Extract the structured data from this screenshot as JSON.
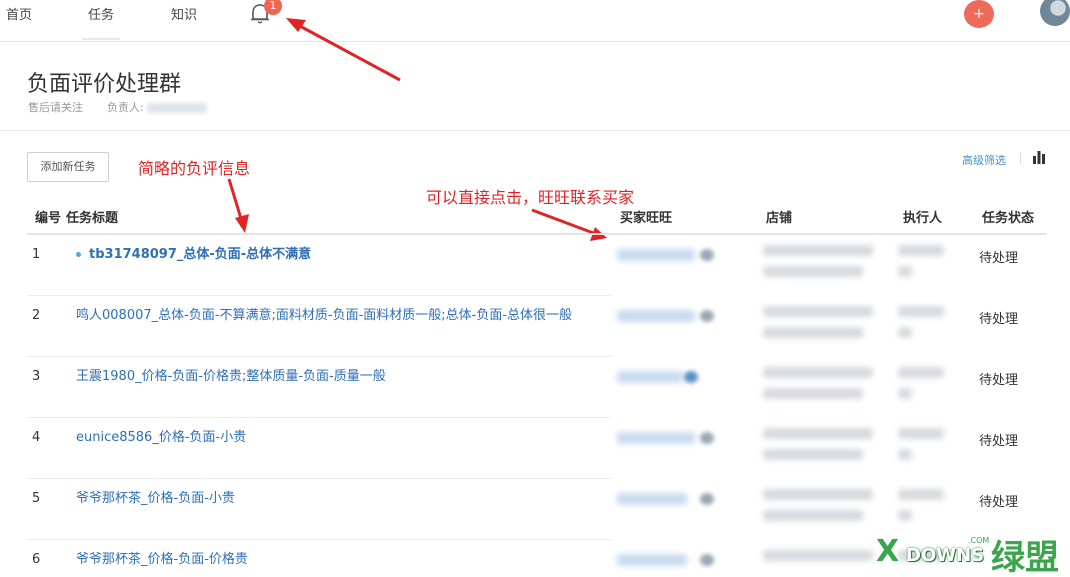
{
  "nav": {
    "items": [
      "首页",
      "任务",
      "知识"
    ],
    "notification_count": "1",
    "add_label": "+"
  },
  "group": {
    "title": "负面评价处理群",
    "subtitle": "售后请关注",
    "owner_label": "负责人:"
  },
  "toolbar": {
    "add_task": "添加新任务",
    "advanced_filter": "高级筛选"
  },
  "annotations": {
    "brief": "简略的负评信息",
    "wangwang": "可以直接点击，旺旺联系买家"
  },
  "table": {
    "headers": [
      "编号",
      "任务标题",
      "买家旺旺",
      "店铺",
      "执行人",
      "任务状态"
    ],
    "rows": [
      {
        "num": "1",
        "title": "tb31748097_总体-负面-总体不满意",
        "status": "待处理"
      },
      {
        "num": "2",
        "title": "鸣人008007_总体-负面-不算满意;面料材质-负面-面料材质一般;总体-负面-总体很一般",
        "status": "待处理"
      },
      {
        "num": "3",
        "title": "王震1980_价格-负面-价格贵;整体质量-负面-质量一般",
        "status": "待处理"
      },
      {
        "num": "4",
        "title": "eunice8586_价格-负面-小贵",
        "status": "待处理"
      },
      {
        "num": "5",
        "title": "爷爷那杯茶_价格-负面-小贵",
        "status": "待处理"
      },
      {
        "num": "6",
        "title": "爷爷那杯茶_价格-负面-价格贵",
        "status": ""
      }
    ]
  },
  "watermark": {
    "x": "X",
    "downs": "DOWNS",
    "com": ".COM",
    "cn": "绿盟"
  },
  "colors": {
    "link": "#2e6fb8",
    "annotation": "#e02424",
    "badge": "#f06450",
    "add_button": "#ee6a5b"
  }
}
